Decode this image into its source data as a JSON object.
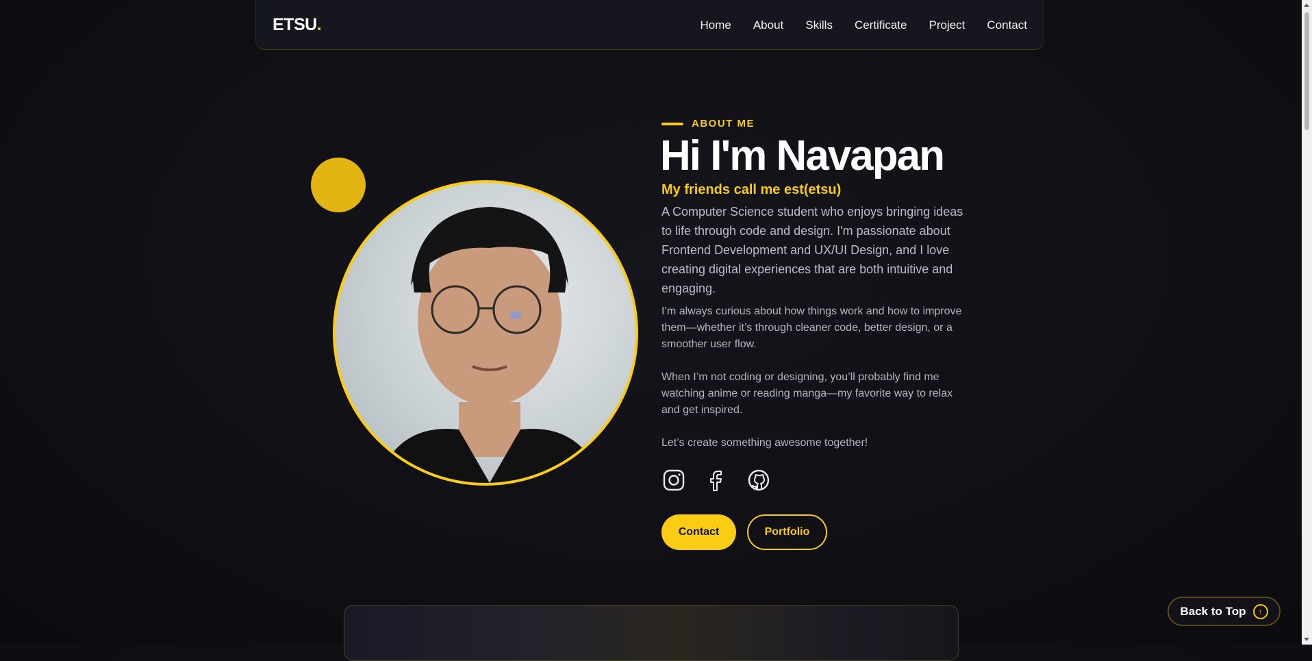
{
  "nav": {
    "logo_text": "ETSU",
    "logo_dot": ".",
    "links": [
      "Home",
      "About",
      "Skills",
      "Certificate",
      "Project",
      "Contact"
    ]
  },
  "about": {
    "eyebrow": "ABOUT ME",
    "title": "Hi I'm Navapan",
    "subtitle": "My friends call me est(etsu)",
    "lead": "A Computer Science student who enjoys bringing ideas to life through code and design. I'm passionate about Frontend Development and UX/UI Design, and I love creating digital experiences that are both intuitive and engaging.",
    "paragraphs": [
      "I’m always curious about how things work and how to improve them—whether it’s through cleaner code, better design, or a smoother user flow.",
      "When I’m not coding or designing, you’ll probably find me watching anime or reading manga—my favorite way to relax and get inspired.",
      "Let’s create something awesome together!"
    ],
    "social_icons": [
      "instagram-icon",
      "facebook-icon",
      "github-icon"
    ],
    "buttons": {
      "contact": "Contact",
      "portfolio": "Portfolio"
    }
  },
  "back_to_top": {
    "label": "Back to Top",
    "icon": "arrow-up-circle-icon"
  },
  "colors": {
    "accent": "#facc15",
    "background": "#0f0f14",
    "nav_bg": "#16161e"
  }
}
